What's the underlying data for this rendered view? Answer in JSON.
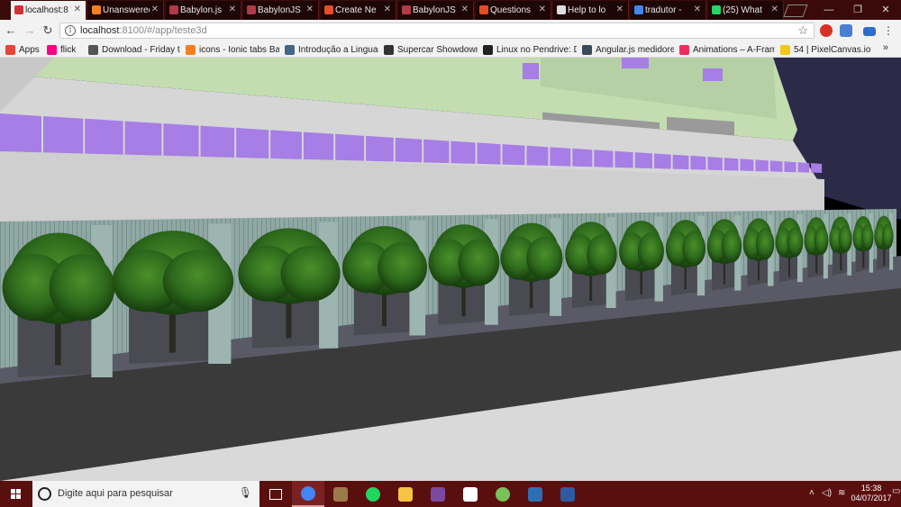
{
  "browser": {
    "tabs": [
      {
        "title": "localhost:8",
        "active": true,
        "favicon_color": "#c33"
      },
      {
        "title": "Unanswered",
        "active": false,
        "favicon_color": "#f48024"
      },
      {
        "title": "Babylon.js",
        "active": false,
        "favicon_color": "#b03a48"
      },
      {
        "title": "BabylonJS",
        "active": false,
        "favicon_color": "#b03a48"
      },
      {
        "title": "Create Ne",
        "active": false,
        "favicon_color": "#e44d26"
      },
      {
        "title": "BabylonJS",
        "active": false,
        "favicon_color": "#b03a48"
      },
      {
        "title": "Questions",
        "active": false,
        "favicon_color": "#e44d26"
      },
      {
        "title": "Help to lo",
        "active": false,
        "favicon_color": "#dddddd"
      },
      {
        "title": "tradutor -",
        "active": false,
        "favicon_color": "#4285f4"
      },
      {
        "title": "(25) What",
        "active": false,
        "favicon_color": "#25d366"
      }
    ],
    "window_controls": {
      "minimize": "—",
      "maximize": "❐",
      "close": "✕"
    },
    "address": {
      "host": "localhost",
      "path": ":8100/#/app/teste3d"
    },
    "bookmarks": [
      {
        "label": "Apps",
        "icon": "apps-grid-icon",
        "color": "#e8453c"
      },
      {
        "label": "flick",
        "icon": "flickr-icon",
        "color": "#ff0084"
      },
      {
        "label": "Download - Friday th",
        "icon": "page-icon",
        "color": "#555555"
      },
      {
        "label": "icons - Ionic tabs Bac",
        "icon": "stackoverflow-icon",
        "color": "#f48024"
      },
      {
        "label": "Introdução a Linguag",
        "icon": "shield-icon",
        "color": "#446688"
      },
      {
        "label": "Supercar Showdown",
        "icon": "supercar-icon",
        "color": "#333333"
      },
      {
        "label": "Linux no Pendrive: De",
        "icon": "tux-icon",
        "color": "#222222"
      },
      {
        "label": "Angular.js medidores",
        "icon": "ng-icon",
        "color": "#3a4a5a"
      },
      {
        "label": "Animations – A-Fram",
        "icon": "aframe-icon",
        "color": "#ef2d5e"
      },
      {
        "label": "54 | PixelCanvas.io",
        "icon": "pixelcanvas-icon",
        "color": "#f5c518"
      }
    ],
    "bookmarks_more": "»"
  },
  "taskbar": {
    "search_placeholder": "Digite aqui para pesquisar",
    "time": "15:38",
    "date": "04/07/2017",
    "apps": [
      {
        "name": "task-view-icon",
        "color": "#ffffff"
      },
      {
        "name": "chrome-icon",
        "color": "#4285f4",
        "active": true
      },
      {
        "name": "game-app-icon",
        "color": "#9c7a4a"
      },
      {
        "name": "spotify-icon",
        "color": "#1ed760"
      },
      {
        "name": "file-explorer-icon",
        "color": "#f6c342"
      },
      {
        "name": "winrar-icon",
        "color": "#7a4aa0"
      },
      {
        "name": "mail-icon",
        "color": "#ffffff"
      },
      {
        "name": "android-studio-icon",
        "color": "#78c257"
      },
      {
        "name": "virtualbox-icon",
        "color": "#2c6fb5"
      },
      {
        "name": "powershell-icon",
        "color": "#2d5aa0"
      }
    ],
    "tray_icons": [
      "chevron-up-icon",
      "speaker-icon",
      "wifi-icon",
      "notifications-icon"
    ]
  },
  "scene": {
    "sky_color": "#000000",
    "building_color": "#d0d0d0",
    "roof_color": "#c9dfb6",
    "window_color": "#a77de6",
    "tower_color": "#2c2c4a",
    "wall_color": "#8ca3a0",
    "tree_color": "#2f6d1e",
    "street_color": "#3c3c3c",
    "sidewalk_color": "#d9d9d9"
  }
}
